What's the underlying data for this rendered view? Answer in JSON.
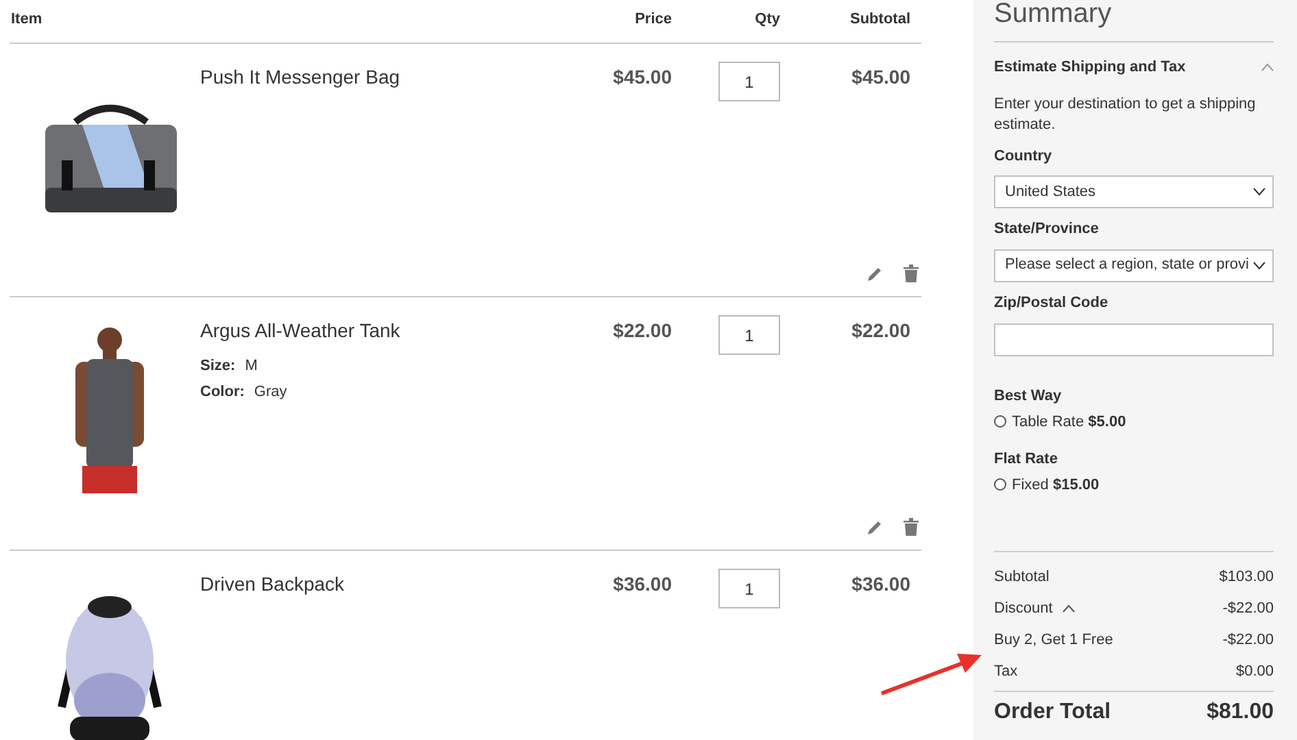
{
  "cart": {
    "columns": [
      "Item",
      "Price",
      "Qty",
      "Subtotal"
    ],
    "items": [
      {
        "name": "Push It Messenger Bag",
        "price": "$45.00",
        "qty": "1",
        "subtotal": "$45.00",
        "actions": true
      },
      {
        "name": "Argus All-Weather Tank",
        "price": "$22.00",
        "qty": "1",
        "subtotal": "$22.00",
        "options": [
          {
            "label": "Size:",
            "value": "M"
          },
          {
            "label": "Color:",
            "value": "Gray"
          }
        ],
        "actions": true
      },
      {
        "name": "Driven Backpack",
        "price": "$36.00",
        "qty": "1",
        "subtotal": "$36.00"
      }
    ]
  },
  "summary": {
    "title": "Summary",
    "estimate": {
      "title": "Estimate Shipping and Tax",
      "expanded": true,
      "intro": "Enter your destination to get a shipping estimate.",
      "fields": [
        {
          "kind": "select",
          "label": "Country",
          "value": "United States"
        },
        {
          "kind": "select",
          "label": "State/Province",
          "value": "Please select a region, state or provi"
        },
        {
          "kind": "input",
          "label": "Zip/Postal Code"
        }
      ]
    },
    "shipping": [
      {
        "carrier": "Best Way",
        "options": [
          {
            "label": "Table Rate",
            "price": "$5.00",
            "selected": false
          }
        ]
      },
      {
        "carrier": "Flat Rate",
        "options": [
          {
            "label": "Fixed",
            "price": "$15.00",
            "selected": false
          }
        ]
      }
    ],
    "totals": [
      {
        "kind": "plain",
        "label": "Subtotal",
        "value": "$103.00"
      },
      {
        "kind": "toggle",
        "label": "Discount",
        "value": "-$22.00",
        "expanded": true
      },
      {
        "kind": "plain",
        "label": "Buy 2, Get 1 Free",
        "value": "-$22.00"
      },
      {
        "kind": "plain",
        "label": "Tax",
        "value": "$0.00"
      }
    ],
    "order_total": {
      "label": "Order Total",
      "value": "$81.00"
    }
  }
}
